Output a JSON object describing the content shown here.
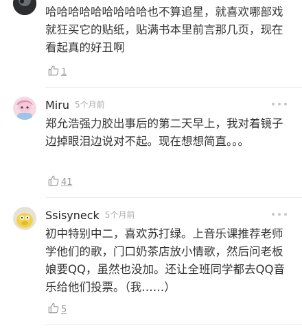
{
  "comments": [
    {
      "username": "",
      "time": "",
      "text": "哈哈哈哈哈哈哈哈哈也不算追星，就喜欢哪部戏就狂买它的贴纸，贴满书本里前言那几页，现在看起真的好丑啊",
      "likes": "1"
    },
    {
      "username": "Miru",
      "time": "5个月前",
      "text": "郑允浩强力胶出事后的第二天早上，我对着镜子边掉眼泪边说对不起。现在想想简直。。。",
      "likes": "41"
    },
    {
      "username": "Ssisyneck",
      "time": "5个月前",
      "text": "初中特别中二，喜欢苏打绿。上音乐课推荐老师学他们的歌，门口奶茶店放小情歌，然后问老板娘要QQ，虽然也没加。还让全班同学都去QQ音乐给他们投票。（我……）",
      "likes": "5"
    }
  ],
  "colors": {
    "text": "#333333",
    "meta": "#aaaaaa",
    "divider": "#ececec"
  },
  "icons": [
    "thumbs-up-icon",
    "more-icon",
    "avatar"
  ]
}
